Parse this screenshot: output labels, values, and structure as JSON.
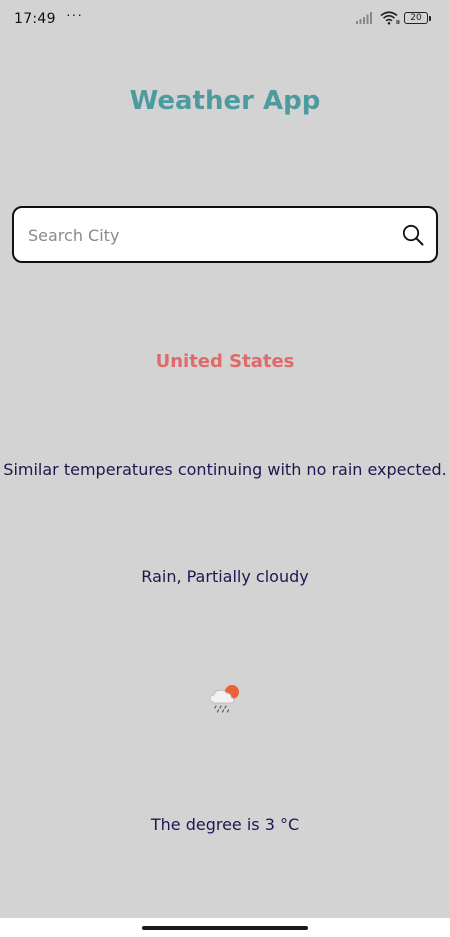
{
  "status_bar": {
    "time": "17:49",
    "dots": "···",
    "battery": "20",
    "icons": [
      "signal-icon",
      "wifi-icon",
      "battery-icon"
    ]
  },
  "app": {
    "title": "Weather App"
  },
  "search": {
    "placeholder": "Search City",
    "value": "",
    "icon": "search-icon"
  },
  "weather": {
    "country": "United States",
    "description": "Similar temperatures continuing with no rain expected.",
    "conditions": "Rain, Partially cloudy",
    "icon": "rain-partly-cloudy-icon",
    "temperature_text": "The degree is 3 °C"
  },
  "colors": {
    "background": "#d3d3d3",
    "title": "#4d9a9f",
    "country": "#e06a6a",
    "body_text": "#1c1850"
  }
}
